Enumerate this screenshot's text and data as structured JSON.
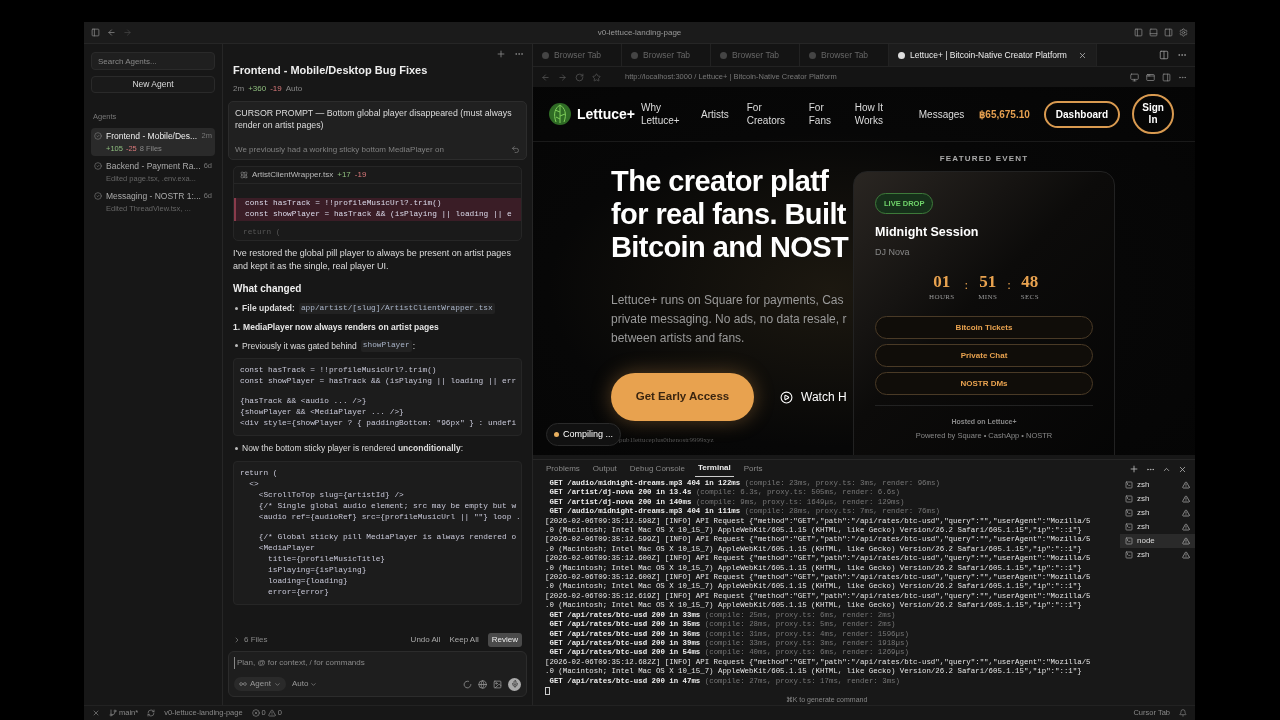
{
  "window": {
    "title": "v0-lettuce-landing-page"
  },
  "sidebar": {
    "search": {
      "placeholder": "Search Agents..."
    },
    "new_agent": "New Agent",
    "section": "Agents",
    "items": [
      {
        "kind": "diff",
        "title": "Frontend - Mobile/Des...",
        "time": "2m",
        "added": "+105",
        "removed": "-25",
        "files": "8 Files",
        "selected": true
      },
      {
        "kind": "edited",
        "title": "Backend - Payment Ra...",
        "time": "6d",
        "sub": "Edited page.tsx, .env.exa...",
        "selected": false
      },
      {
        "kind": "edited",
        "title": "Messaging - NOSTR 1:...",
        "time": "6d",
        "sub": "Edited ThreadView.tsx, ...",
        "selected": false
      }
    ]
  },
  "chat": {
    "title": "Frontend - Mobile/Desktop Bug Fixes",
    "time": "2m",
    "added": "+360",
    "removed": "-19",
    "mode": "Auto",
    "prompt": {
      "text": "CURSOR PROMPT — Bottom global player disappeared (must always render on artist pages)",
      "faded": "We previously had a working sticky bottom MediaPlayer on"
    },
    "file_diff": {
      "name": "ArtistClientWrapper.tsx",
      "added": "+17",
      "removed": "-19",
      "lines": [
        {
          "kind": "deleted",
          "text": "const hasTrack = !!profileMusicUrl?.trim()"
        },
        {
          "kind": "deleted",
          "text": "const showPlayer = hasTrack && (isPlaying || loading || e"
        },
        {
          "kind": "faded",
          "text": "return ("
        }
      ]
    },
    "blocks": [
      {
        "kind": "paragraph",
        "text": "I've restored the global pill player to always be present on artist pages and kept it as the single, real player UI."
      },
      {
        "kind": "heading",
        "text": "What changed"
      },
      {
        "kind": "bullet",
        "text": "**File updated:**",
        "code": "app/artist/[slug]/ArtistClientWrapper.tsx"
      },
      {
        "kind": "numbered",
        "marker": "1.",
        "text": "MediaPlayer now always renders on artist pages"
      },
      {
        "kind": "bullet",
        "text": "Previously it was gated behind",
        "code": "showPlayer",
        "after": ":"
      },
      {
        "kind": "code",
        "groups": [
          [
            "const hasTrack = !!profileMusicUrl?.trim()",
            "const showPlayer = hasTrack && (isPlaying || loading || err"
          ],
          [
            "{hasTrack && <audio ... />}",
            "{showPlayer && <MediaPlayer ... />}",
            "<div style={showPlayer ? { paddingBottom: \"96px\" } : undefi"
          ]
        ]
      },
      {
        "kind": "bullet",
        "text": "Now the bottom sticky player is rendered **unconditionally**:"
      },
      {
        "kind": "code",
        "groups": [
          [
            "return (",
            "  <>",
            "    <ScrollToTop slug={artistId} />",
            "    {/* Single global audio element; src may be empty but w",
            "    <audio ref={audioRef} src={profileMusicUrl || \"\"} loop ."
          ],
          [
            "    {/* Global sticky pill MediaPlayer is always rendered o",
            "    <MediaPlayer",
            "      title={profileMusicTitle}",
            "      isPlaying={isPlaying}",
            "      loading={loading}",
            "      error={error}"
          ]
        ]
      }
    ],
    "footer": {
      "files": "6 Files",
      "undo": "Undo All",
      "keep": "Keep All",
      "review": "Review"
    },
    "composer": {
      "placeholder": "Plan, @ for context, / for commands",
      "agent": "Agent",
      "model": "Auto"
    }
  },
  "browser": {
    "tabs": [
      {
        "title": "Browser Tab",
        "selected": false
      },
      {
        "title": "Browser Tab",
        "selected": false
      },
      {
        "title": "Browser Tab",
        "selected": false
      },
      {
        "title": "Browser Tab",
        "selected": false
      },
      {
        "title": "Lettuce+ | Bitcoin-Native Creator Platform",
        "selected": true
      }
    ],
    "url": "http://localhost:3000 / Lettuce+ | Bitcoin-Native Creator Platform"
  },
  "page": {
    "brand": "Lettuce+",
    "nav": [
      "Why Lettuce+",
      "Artists",
      "For Creators",
      "For Fans",
      "How It Works",
      "Messages"
    ],
    "price": "฿65,675.10",
    "dashboard": "Dashboard",
    "sign_in": "Sign In",
    "headline": [
      "The creator platf",
      "for real fans. Built",
      "Bitcoin and NOST"
    ],
    "intro": [
      "Lettuce+ runs on Square for payments, Cas",
      "private messaging. No ads, no data resale, r",
      "between artists and fans."
    ],
    "cta": "Get Early Access",
    "watch": "Watch H",
    "npub": "pub1lettuceplus0thenostr9999xyz",
    "compiling": "Compiling ...",
    "featured": {
      "label": "FEATURED EVENT",
      "badge": "LIVE DROP",
      "title": "Midnight Session",
      "artist": "DJ Nova",
      "separator": ":",
      "countdown": [
        {
          "value": "01",
          "unit": "HOURS"
        },
        {
          "value": "51",
          "unit": "MINS"
        },
        {
          "value": "48",
          "unit": "SECS"
        }
      ],
      "actions": [
        "Bitcoin Tickets",
        "Private Chat",
        "NOSTR DMs"
      ],
      "hosted": "Hosted on Lettuce+",
      "powered": "Powered by Square • CashApp • NOSTR"
    }
  },
  "terminal": {
    "tabs": [
      {
        "label": "Problems",
        "selected": false
      },
      {
        "label": "Output",
        "selected": false
      },
      {
        "label": "Debug Console",
        "selected": false
      },
      {
        "label": "Terminal",
        "selected": true
      },
      {
        "label": "Ports",
        "selected": false
      }
    ],
    "lines": [
      {
        "kind": "request",
        "text": "GET /audio/midnight-dreams.mp3 404 in 122ms",
        "dim": "(compile: 23ms, proxy.ts: 3ms, render: 96ms)"
      },
      {
        "kind": "request",
        "text": "GET /artist/dj-nova 200 in 13.4s",
        "dim": "(compile: 6.3s, proxy.ts: 505ms, render: 6.6s)"
      },
      {
        "kind": "request",
        "text": "GET /artist/dj-nova 200 in 140ms",
        "dim": "(compile: 9ms, proxy.ts: 1649µs, render: 129ms)"
      },
      {
        "kind": "request",
        "text": "GET /audio/midnight-dreams.mp3 404 in 111ms",
        "dim": "(compile: 28ms, proxy.ts: 7ms, render: 76ms)"
      },
      {
        "kind": "log",
        "text": "[2026-02-06T09:35:12.598Z] [INFO] API Request {\"method\":\"GET\",\"path\":\"/api/rates/btc-usd\",\"query\":\"\",\"userAgent\":\"Mozilla/5"
      },
      {
        "kind": "log",
        "text": ".0 (Macintosh; Intel Mac OS X 10_15_7) AppleWebKit/605.1.15 (KHTML, like Gecko) Version/26.2 Safari/605.1.15\",\"ip\":\"::1\"}"
      },
      {
        "kind": "log",
        "text": "[2026-02-06T09:35:12.599Z] [INFO] API Request {\"method\":\"GET\",\"path\":\"/api/rates/btc-usd\",\"query\":\"\",\"userAgent\":\"Mozilla/5"
      },
      {
        "kind": "log",
        "text": ".0 (Macintosh; Intel Mac OS X 10_15_7) AppleWebKit/605.1.15 (KHTML, like Gecko) Version/26.2 Safari/605.1.15\",\"ip\":\"::1\"}"
      },
      {
        "kind": "log",
        "text": "[2026-02-06T09:35:12.600Z] [INFO] API Request {\"method\":\"GET\",\"path\":\"/api/rates/btc-usd\",\"query\":\"\",\"userAgent\":\"Mozilla/5"
      },
      {
        "kind": "log",
        "text": ".0 (Macintosh; Intel Mac OS X 10_15_7) AppleWebKit/605.1.15 (KHTML, like Gecko) Version/26.2 Safari/605.1.15\",\"ip\":\"::1\"}"
      },
      {
        "kind": "log",
        "text": "[2026-02-06T09:35:12.600Z] [INFO] API Request {\"method\":\"GET\",\"path\":\"/api/rates/btc-usd\",\"query\":\"\",\"userAgent\":\"Mozilla/5"
      },
      {
        "kind": "log",
        "text": ".0 (Macintosh; Intel Mac OS X 10_15_7) AppleWebKit/605.1.15 (KHTML, like Gecko) Version/26.2 Safari/605.1.15\",\"ip\":\"::1\"}"
      },
      {
        "kind": "log",
        "text": "[2026-02-06T09:35:12.619Z] [INFO] API Request {\"method\":\"GET\",\"path\":\"/api/rates/btc-usd\",\"query\":\"\",\"userAgent\":\"Mozilla/5"
      },
      {
        "kind": "log",
        "text": ".0 (Macintosh; Intel Mac OS X 10_15_7) AppleWebKit/605.1.15 (KHTML, like Gecko) Version/26.2 Safari/605.1.15\",\"ip\":\"::1\"}"
      },
      {
        "kind": "request",
        "text": "GET /api/rates/btc-usd 200 in 33ms",
        "dim": "(compile: 25ms, proxy.ts: 6ms, render: 2ms)"
      },
      {
        "kind": "request",
        "text": "GET /api/rates/btc-usd 200 in 35ms",
        "dim": "(compile: 28ms, proxy.ts: 5ms, render: 2ms)"
      },
      {
        "kind": "request",
        "text": "GET /api/rates/btc-usd 200 in 36ms",
        "dim": "(compile: 31ms, proxy.ts: 4ms, render: 1596µs)"
      },
      {
        "kind": "request",
        "text": "GET /api/rates/btc-usd 200 in 39ms",
        "dim": "(compile: 33ms, proxy.ts: 3ms, render: 1918µs)"
      },
      {
        "kind": "request",
        "text": "GET /api/rates/btc-usd 200 in 54ms",
        "dim": "(compile: 40ms, proxy.ts: 6ms, render: 1269µs)"
      },
      {
        "kind": "log",
        "text": "[2026-02-06T09:35:12.682Z] [INFO] API Request {\"method\":\"GET\",\"path\":\"/api/rates/btc-usd\",\"query\":\"\",\"userAgent\":\"Mozilla/5"
      },
      {
        "kind": "log",
        "text": ".0 (Macintosh; Intel Mac OS X 10_15_7) AppleWebKit/605.1.15 (KHTML, like Gecko) Version/26.2 Safari/605.1.15\",\"ip\":\"::1\"}"
      },
      {
        "kind": "request",
        "text": "GET /api/rates/btc-usd 200 in 47ms",
        "dim": "(compile: 27ms, proxy.ts: 17ms, render: 3ms)"
      }
    ],
    "hint": "⌘K to generate command",
    "sessions": [
      {
        "name": "zsh",
        "selected": false
      },
      {
        "name": "zsh",
        "selected": false
      },
      {
        "name": "zsh",
        "selected": false
      },
      {
        "name": "zsh",
        "selected": false
      },
      {
        "name": "node",
        "selected": true
      },
      {
        "name": "zsh",
        "selected": false
      }
    ]
  },
  "status_bar": {
    "branch": "main*",
    "project": "v0-lettuce-landing-page",
    "errors": "0",
    "warnings": "0",
    "right": "Cursor Tab"
  }
}
